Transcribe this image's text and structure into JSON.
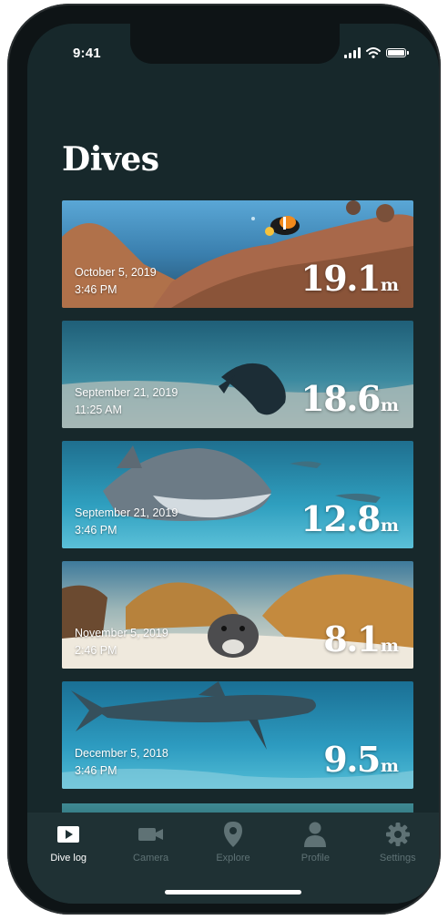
{
  "status_bar": {
    "time": "9:41"
  },
  "page": {
    "title": "Dives"
  },
  "dives": [
    {
      "date": "October 5, 2019",
      "time": "3:46 PM",
      "depth": "19.1",
      "unit": "m"
    },
    {
      "date": "September 21, 2019",
      "time": "11:25 AM",
      "depth": "18.6",
      "unit": "m"
    },
    {
      "date": "September 21, 2019",
      "time": "3:46 PM",
      "depth": "12.8",
      "unit": "m"
    },
    {
      "date": "November 5, 2019",
      "time": "2:46 PM",
      "depth": "8.1",
      "unit": "m"
    },
    {
      "date": "December 5, 2018",
      "time": "3:46 PM",
      "depth": "9.5",
      "unit": "m"
    }
  ],
  "tab_bar": {
    "tabs": [
      {
        "label": "Dive log",
        "icon": "play-icon",
        "active": true
      },
      {
        "label": "Camera",
        "icon": "video-camera-icon",
        "active": false
      },
      {
        "label": "Explore",
        "icon": "map-pin-icon",
        "active": false
      },
      {
        "label": "Profile",
        "icon": "person-icon",
        "active": false
      },
      {
        "label": "Settings",
        "icon": "gear-icon",
        "active": false
      }
    ]
  },
  "colors": {
    "background": "#17282b",
    "tab_bar": "#1f3134",
    "inactive_tab": "#5f7275",
    "active_tab": "#ffffff"
  }
}
